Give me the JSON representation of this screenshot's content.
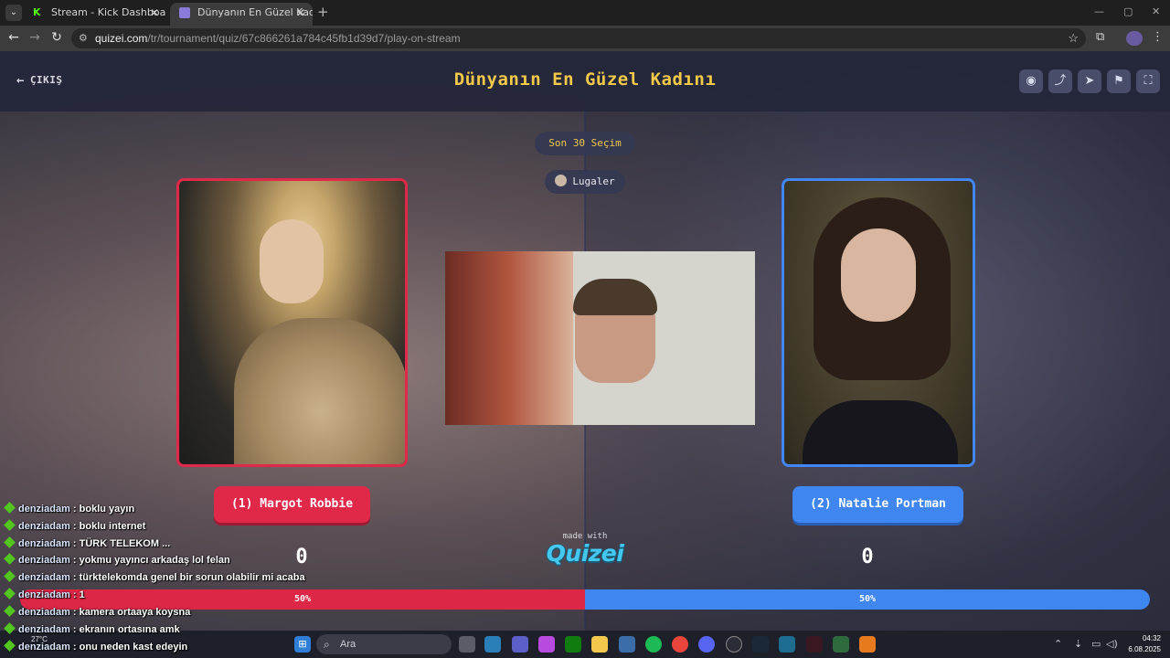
{
  "browser": {
    "tabs": [
      {
        "label": "Stream - Kick Dashboard",
        "active": false
      },
      {
        "label": "Dünyanın En Güzel Kadını - Qu",
        "active": true
      }
    ],
    "url_host": "quizei.com",
    "url_path": "/tr/tournament/quiz/67c866261a784c45fb1d39d7/play-on-stream"
  },
  "header": {
    "exit_label": "ÇIKIŞ",
    "title": "Dünyanın En Güzel Kadını",
    "tool_icons": [
      "eye-icon",
      "share-icon",
      "send-icon",
      "flag-icon",
      "fullscreen-icon"
    ]
  },
  "match": {
    "round_label": "Son 30 Seçim",
    "host_name": "Lugaler",
    "left": {
      "label": "(1) Margot Robbie",
      "score": "0",
      "percent": 50,
      "percent_label": "50%",
      "color": "#dc2746"
    },
    "right": {
      "label": "(2) Natalie Portman",
      "score": "0",
      "percent": 50,
      "percent_label": "50%",
      "color": "#3f86f0"
    }
  },
  "branding": {
    "made_with": "made with",
    "logo": "Quizei"
  },
  "chat": [
    {
      "user": "denziadam",
      "text": ": boklu yayın"
    },
    {
      "user": "denziadam",
      "text": ": boklu internet"
    },
    {
      "user": "denziadam",
      "text": ": TÜRK TELEKOM ..."
    },
    {
      "user": "denziadam",
      "text": ": yokmu yayıncı arkadaş lol felan"
    },
    {
      "user": "denziadam",
      "text": ": türktelekomda genel bir sorun olabilir mi acaba"
    },
    {
      "user": "denziadam",
      "text": ": 1"
    },
    {
      "user": "denziadam",
      "text": ": kamera ortaaya koysna"
    },
    {
      "user": "denziadam",
      "text": ": ekranın ortasına amk"
    },
    {
      "user": "denziadam",
      "text": ": onu neden kast edeyin"
    }
  ],
  "taskbar": {
    "weather": "27°C",
    "search_placeholder": "Ara",
    "time": "04:32",
    "date": "6.08.2025"
  }
}
